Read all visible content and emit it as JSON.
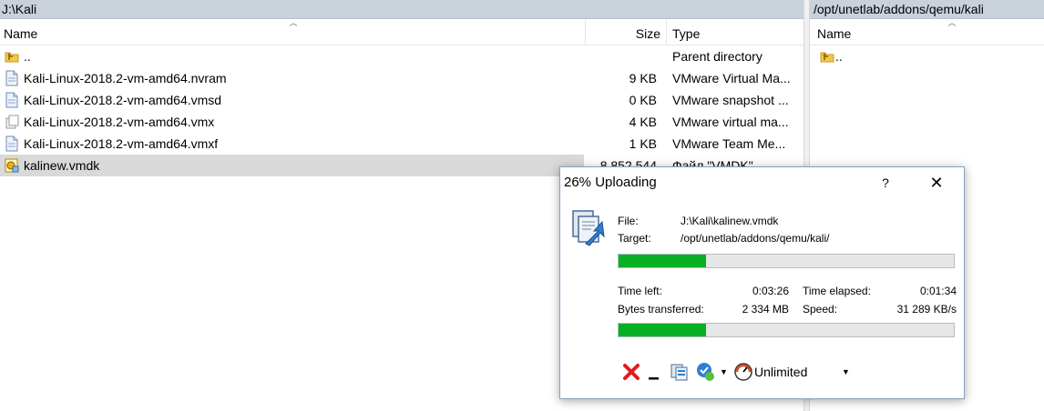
{
  "left_pane": {
    "path": "J:\\Kali",
    "columns": {
      "name": "Name",
      "size": "Size",
      "type": "Type"
    },
    "rows": [
      {
        "name": "..",
        "size": "",
        "type": "Parent directory",
        "icon": "parent-folder-icon"
      },
      {
        "name": "Kali-Linux-2018.2-vm-amd64.nvram",
        "size": "9 KB",
        "type": "VMware Virtual Ma...",
        "icon": "file-icon"
      },
      {
        "name": "Kali-Linux-2018.2-vm-amd64.vmsd",
        "size": "0 KB",
        "type": "VMware snapshot ...",
        "icon": "file-icon"
      },
      {
        "name": "Kali-Linux-2018.2-vm-amd64.vmx",
        "size": "4 KB",
        "type": "VMware virtual ma...",
        "icon": "vmx-file-icon"
      },
      {
        "name": "Kali-Linux-2018.2-vm-amd64.vmxf",
        "size": "1 KB",
        "type": "VMware Team Me...",
        "icon": "file-icon"
      },
      {
        "name": "kalinew.vmdk",
        "size": "8 852 544",
        "type": "Файл \"VMDK\"",
        "icon": "vmdk-file-icon",
        "selected": true
      }
    ]
  },
  "right_pane": {
    "path": "/opt/unetlab/addons/qemu/kali",
    "columns": {
      "name": "Name"
    },
    "rows": [
      {
        "name": "..",
        "icon": "parent-folder-icon"
      }
    ]
  },
  "dialog": {
    "title": "26% Uploading",
    "help_label": "?",
    "close_label": "✕",
    "file_label": "File:",
    "file_value": "J:\\Kali\\kalinew.vmdk",
    "target_label": "Target:",
    "target_value": "/opt/unetlab/addons/qemu/kali/",
    "file_progress": 26,
    "total_progress": 26,
    "time_left_label": "Time left:",
    "time_left_value": "0:03:26",
    "time_elapsed_label": "Time elapsed:",
    "time_elapsed_value": "0:01:34",
    "bytes_label": "Bytes transferred:",
    "bytes_value": "2 334 MB",
    "speed_label": "Speed:",
    "speed_value": "31 289 KB/s",
    "speed_limit": "Unlimited",
    "colors": {
      "progress": "#06b025",
      "cancel": "#e01b1b"
    }
  }
}
